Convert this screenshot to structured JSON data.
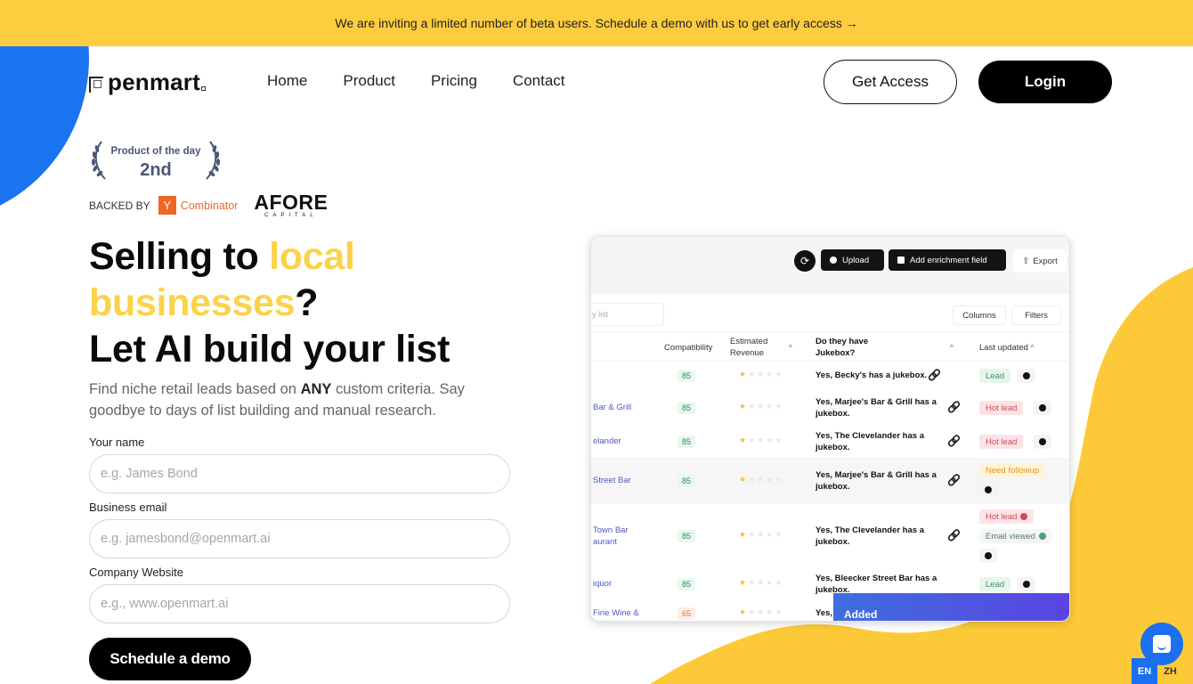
{
  "banner": {
    "text": "We are inviting a limited number of beta users. Schedule a demo with us to get early access →"
  },
  "nav": {
    "logo": "penmart",
    "links": [
      "Home",
      "Product",
      "Pricing",
      "Contact"
    ],
    "get_access": "Get Access",
    "login": "Login"
  },
  "badges": {
    "product_of_day": "Product of the day",
    "rank": "2nd",
    "backed_by": "BACKED BY",
    "yc_letter": "Y",
    "yc_name": "Combinator",
    "afore": "AFORE",
    "afore_sub": "CAPITAL"
  },
  "hero": {
    "line1_a": "Selling to ",
    "line1_b": "local",
    "line2_a": "businesses",
    "line2_b": "?",
    "line3": "Let AI build your list",
    "sub_a": "Find niche retail leads based on ",
    "sub_b": "ANY",
    "sub_c": " custom criteria. Say goodbye to days of list building and manual research."
  },
  "form": {
    "name_label": "Your name",
    "name_placeholder": "e.g. James Bond",
    "email_label": "Business email",
    "email_placeholder": "e.g. jamesbond@openmart.ai",
    "website_label": "Company Website",
    "website_placeholder": "e.g., www.openmart.ai",
    "submit": "Schedule a demo"
  },
  "app": {
    "toolbar": {
      "upload": "Upload",
      "enrich": "Add enrichment field",
      "export": "Export"
    },
    "search_placeholder": "y list",
    "columns": "Columns",
    "filters": "Filters",
    "headers": {
      "compat": "Compatibility",
      "revenue_1": "Estimated",
      "revenue_2": "Revenue",
      "jukebox_1": "Do they have",
      "jukebox_2": "Jukebox?",
      "updated": "Last updated"
    },
    "rows": [
      {
        "name": "",
        "score": "85",
        "stars": 1,
        "answer": "Yes, Becky's has a jukebox.",
        "tags": [
          "Lead"
        ]
      },
      {
        "name": "Bar & Grill",
        "score": "85",
        "stars": 1,
        "answer": "Yes, Marjee's Bar & Grill has a jukebox.",
        "tags": [
          "Hot lead"
        ]
      },
      {
        "name": "elander",
        "score": "85",
        "stars": 1,
        "answer": "Yes, The Clevelander has a jukebox.",
        "tags": [
          "Hot lead"
        ]
      },
      {
        "name": "Street Bar",
        "score": "85",
        "stars": 1,
        "answer": "Yes, Marjee's Bar & Grill has a jukebox.",
        "tags": [
          "Need followup"
        ]
      },
      {
        "name": "Town Bar\naurant",
        "score": "85",
        "stars": 1,
        "answer": "Yes, The Clevelander has a jukebox.",
        "tags": [
          "Hot lead",
          "Email viewed"
        ]
      },
      {
        "name": "iquor",
        "score": "85",
        "stars": 1,
        "answer": "Yes, Bleecker Street Bar has a jukebox.",
        "tags": [
          "Lead"
        ]
      },
      {
        "name": "Fine Wine &",
        "score": "65",
        "stars": 1,
        "answer": "Yes, Rest",
        "tags": []
      }
    ],
    "toast": "Added"
  },
  "lang": {
    "en": "EN",
    "zh": "ZH"
  },
  "colors": {
    "brand_yellow": "#fecd3f",
    "brand_blue": "#1b74f0",
    "highlight": "#fcd24a"
  }
}
